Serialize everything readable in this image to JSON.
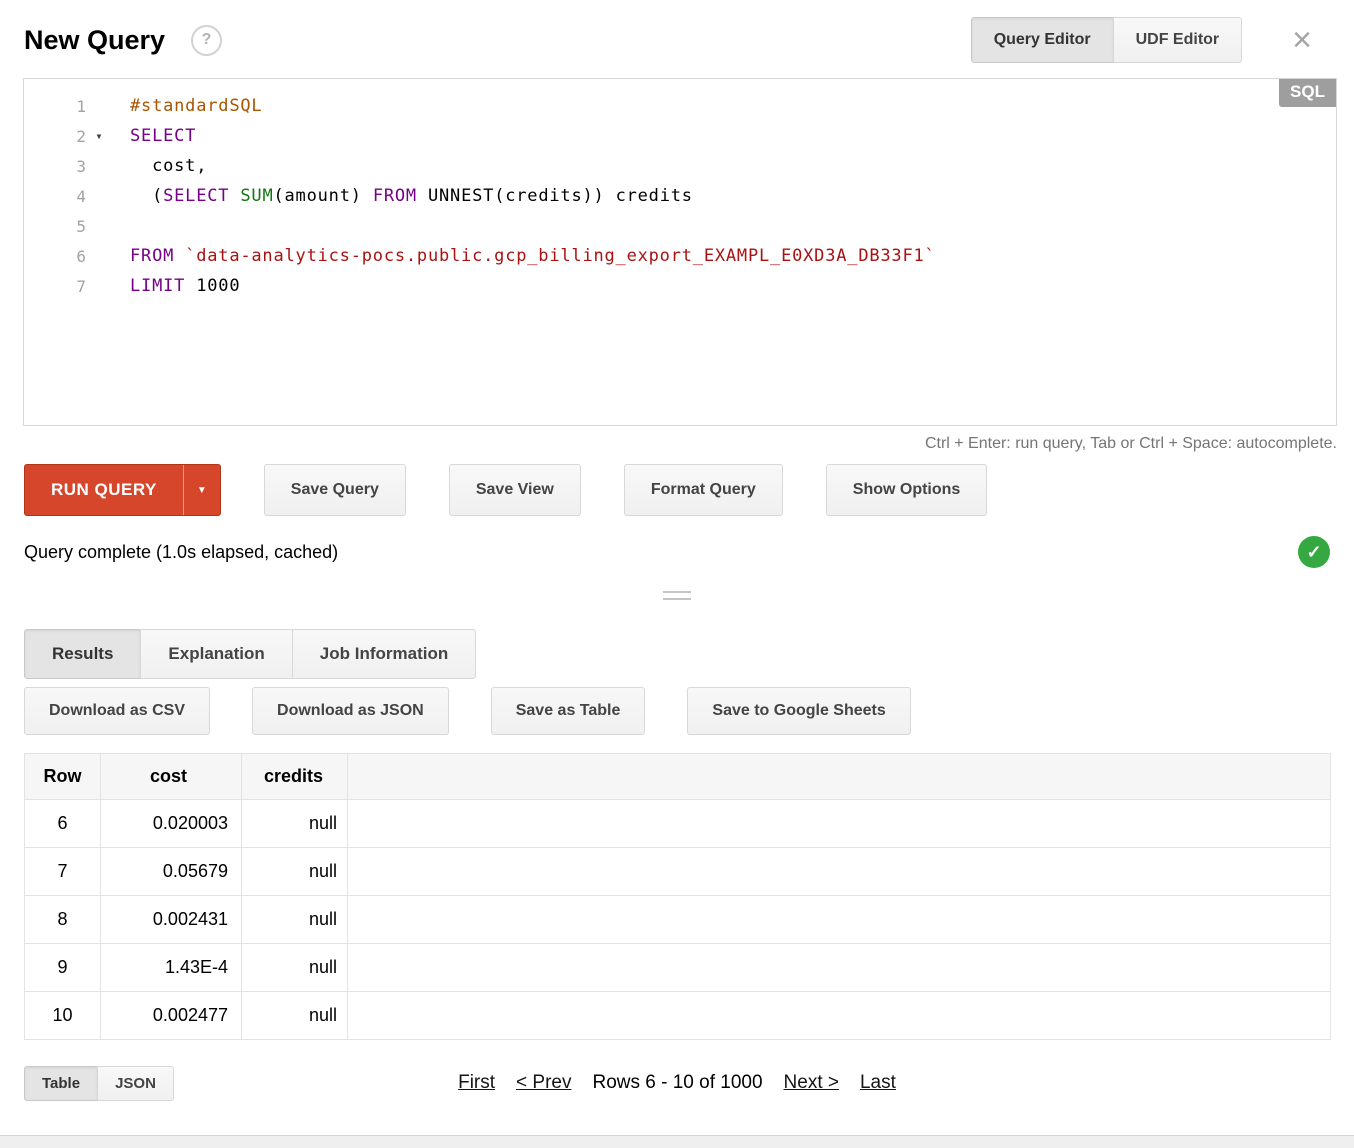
{
  "colors": {
    "run_button": "#d6462b",
    "success_green": "#36a841",
    "sql_badge_bg": "#9e9e9e",
    "keyword": "#770088",
    "comment": "#aa5500",
    "function": "#117711",
    "string": "#aa1111"
  },
  "header": {
    "title": "New Query",
    "help_label": "?",
    "close_label": "×",
    "editor_tabs": [
      {
        "label": "Query Editor",
        "active": true
      },
      {
        "label": "UDF Editor",
        "active": false
      }
    ]
  },
  "editor": {
    "badge": "SQL",
    "hint": "Ctrl + Enter: run query, Tab or Ctrl + Space: autocomplete.",
    "lines": [
      {
        "num": "1",
        "fold": false,
        "tokens": [
          {
            "t": "#standardSQL",
            "c": "comment"
          }
        ]
      },
      {
        "num": "2",
        "fold": true,
        "tokens": [
          {
            "t": "SELECT",
            "c": "keyword"
          }
        ]
      },
      {
        "num": "3",
        "fold": false,
        "tokens": [
          {
            "t": "  cost,",
            "c": "plain"
          }
        ]
      },
      {
        "num": "4",
        "fold": false,
        "tokens": [
          {
            "t": "  (",
            "c": "plain"
          },
          {
            "t": "SELECT",
            "c": "keyword"
          },
          {
            "t": " ",
            "c": "plain"
          },
          {
            "t": "SUM",
            "c": "function"
          },
          {
            "t": "(amount) ",
            "c": "plain"
          },
          {
            "t": "FROM",
            "c": "keyword"
          },
          {
            "t": " UNNEST(credits)) credits",
            "c": "plain"
          }
        ]
      },
      {
        "num": "5",
        "fold": false,
        "tokens": []
      },
      {
        "num": "6",
        "fold": false,
        "tokens": [
          {
            "t": "FROM",
            "c": "keyword"
          },
          {
            "t": " ",
            "c": "plain"
          },
          {
            "t": "`data-analytics-pocs.public.gcp_billing_export_EXAMPL_E0XD3A_DB33F1`",
            "c": "string"
          }
        ]
      },
      {
        "num": "7",
        "fold": false,
        "tokens": [
          {
            "t": "LIMIT",
            "c": "keyword"
          },
          {
            "t": " 1000",
            "c": "plain"
          }
        ]
      }
    ]
  },
  "toolbar": {
    "run_query": "RUN QUERY",
    "dropdown_arrow": "▼",
    "save_query": "Save Query",
    "save_view": "Save View",
    "format_query": "Format Query",
    "show_options": "Show Options"
  },
  "status": {
    "message": "Query complete (1.0s elapsed, cached)",
    "check": "✓"
  },
  "results": {
    "tabs": [
      {
        "label": "Results",
        "active": true
      },
      {
        "label": "Explanation",
        "active": false
      },
      {
        "label": "Job Information",
        "active": false
      }
    ],
    "actions": [
      "Download as CSV",
      "Download as JSON",
      "Save as Table",
      "Save to Google Sheets"
    ],
    "table": {
      "headers": [
        "Row",
        "cost",
        "credits"
      ],
      "rows": [
        {
          "row": "6",
          "cost": "0.020003",
          "credits": "null"
        },
        {
          "row": "7",
          "cost": "0.05679",
          "credits": "null"
        },
        {
          "row": "8",
          "cost": "0.002431",
          "credits": "null"
        },
        {
          "row": "9",
          "cost": "1.43E-4",
          "credits": "null"
        },
        {
          "row": "10",
          "cost": "0.002477",
          "credits": "null"
        }
      ]
    },
    "view_toggle": [
      {
        "label": "Table",
        "active": true
      },
      {
        "label": "JSON",
        "active": false
      }
    ],
    "pagination": {
      "first": "First",
      "prev": "< Prev",
      "info": "Rows 6 - 10 of 1000",
      "next": "Next >",
      "last": "Last"
    }
  }
}
